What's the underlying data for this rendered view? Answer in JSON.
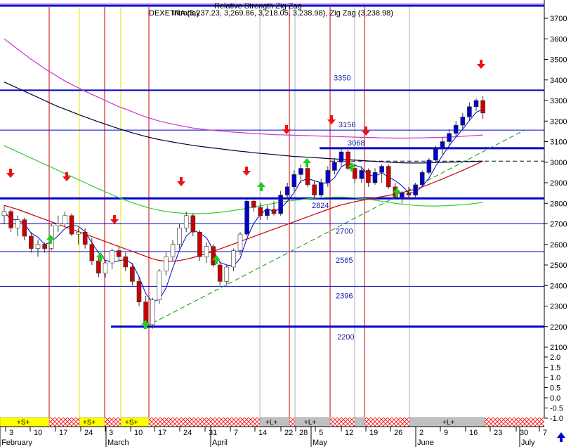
{
  "header": {
    "title_overlay": "Relative Strength Zig Zag",
    "sub_overlay": "Intraday",
    "ohlc_text": "DEXETRA (3,237.23, 3,269.86, 3,218.05, 3,238.98), Zig Zag (3,238.98)"
  },
  "colors": {
    "level_line": "#0000cc",
    "uptrend": "#009900",
    "ma_magenta": "#cc33cc",
    "ma_navy": "#000033",
    "ma_green": "#33cc33",
    "ma_red": "#cc0000",
    "band_s": "#ffff00",
    "band_l": "#c0c0c0",
    "hatch": "#ff0000",
    "cycle_red": "#cc0000",
    "cycle_yellow": "#e8e000",
    "cycle_gray": "#b0b0b0"
  },
  "band_labels": [
    "+S+",
    "+S+",
    "+S+",
    "+L+",
    "+L+",
    "+L+"
  ],
  "scroll_icon": "arrow-up-icon",
  "chart_data": {
    "type": "candlestick",
    "title": "",
    "yticks": [
      3700,
      3600,
      3500,
      3400,
      3300,
      3200,
      3100,
      3000,
      2900,
      2800,
      2700,
      2600,
      2500,
      2400,
      2300,
      2200,
      2100
    ],
    "osc_ticks": [
      "2.0",
      "1.5",
      "1.0",
      "0.5",
      "0.0",
      "-0.5",
      "-1.0"
    ],
    "ylim": [
      2000,
      3750
    ],
    "x_ticks": [
      "3",
      "10",
      "17",
      "24",
      "3",
      "10",
      "17",
      "24",
      "31",
      "7",
      "14",
      "22",
      "28",
      "5",
      "12",
      "19",
      "26",
      "2",
      "9",
      "16",
      "23",
      "30",
      "7"
    ],
    "month_labels": [
      "February",
      "March",
      "April",
      "May",
      "June",
      "July"
    ],
    "levels": [
      {
        "value": 3350,
        "label": "3350"
      },
      {
        "value": 3156,
        "label": "3156"
      },
      {
        "value": 3068,
        "label": "3068"
      },
      {
        "value": 2824,
        "label": "2824"
      },
      {
        "value": 2700,
        "label": "2700"
      },
      {
        "value": 2565,
        "label": "2565"
      },
      {
        "value": 2396,
        "label": "2396"
      },
      {
        "value": 2200,
        "label": "2200"
      }
    ],
    "candles": [
      {
        "o": 2740,
        "h": 2790,
        "l": 2700,
        "c": 2760
      },
      {
        "o": 2760,
        "h": 2770,
        "l": 2660,
        "c": 2680
      },
      {
        "o": 2680,
        "h": 2740,
        "l": 2640,
        "c": 2720
      },
      {
        "o": 2720,
        "h": 2730,
        "l": 2620,
        "c": 2640
      },
      {
        "o": 2640,
        "h": 2660,
        "l": 2560,
        "c": 2580
      },
      {
        "o": 2580,
        "h": 2620,
        "l": 2540,
        "c": 2600
      },
      {
        "o": 2600,
        "h": 2610,
        "l": 2560,
        "c": 2580
      },
      {
        "o": 2580,
        "h": 2700,
        "l": 2570,
        "c": 2690
      },
      {
        "o": 2690,
        "h": 2740,
        "l": 2660,
        "c": 2700
      },
      {
        "o": 2700,
        "h": 2760,
        "l": 2690,
        "c": 2740
      },
      {
        "o": 2740,
        "h": 2750,
        "l": 2640,
        "c": 2650
      },
      {
        "o": 2650,
        "h": 2680,
        "l": 2600,
        "c": 2660
      },
      {
        "o": 2660,
        "h": 2680,
        "l": 2580,
        "c": 2600
      },
      {
        "o": 2600,
        "h": 2630,
        "l": 2500,
        "c": 2520
      },
      {
        "o": 2520,
        "h": 2550,
        "l": 2440,
        "c": 2460
      },
      {
        "o": 2460,
        "h": 2520,
        "l": 2440,
        "c": 2510
      },
      {
        "o": 2510,
        "h": 2580,
        "l": 2480,
        "c": 2570
      },
      {
        "o": 2570,
        "h": 2590,
        "l": 2520,
        "c": 2540
      },
      {
        "o": 2540,
        "h": 2560,
        "l": 2470,
        "c": 2490
      },
      {
        "o": 2490,
        "h": 2510,
        "l": 2400,
        "c": 2420
      },
      {
        "o": 2420,
        "h": 2440,
        "l": 2300,
        "c": 2320
      },
      {
        "o": 2320,
        "h": 2350,
        "l": 2200,
        "c": 2210
      },
      {
        "o": 2210,
        "h": 2340,
        "l": 2190,
        "c": 2330
      },
      {
        "o": 2330,
        "h": 2480,
        "l": 2310,
        "c": 2470
      },
      {
        "o": 2470,
        "h": 2560,
        "l": 2450,
        "c": 2540
      },
      {
        "o": 2540,
        "h": 2620,
        "l": 2520,
        "c": 2600
      },
      {
        "o": 2600,
        "h": 2700,
        "l": 2580,
        "c": 2680
      },
      {
        "o": 2680,
        "h": 2760,
        "l": 2660,
        "c": 2740
      },
      {
        "o": 2740,
        "h": 2750,
        "l": 2640,
        "c": 2660
      },
      {
        "o": 2660,
        "h": 2670,
        "l": 2520,
        "c": 2540
      },
      {
        "o": 2540,
        "h": 2610,
        "l": 2510,
        "c": 2590
      },
      {
        "o": 2590,
        "h": 2600,
        "l": 2490,
        "c": 2500
      },
      {
        "o": 2500,
        "h": 2520,
        "l": 2400,
        "c": 2420
      },
      {
        "o": 2420,
        "h": 2500,
        "l": 2400,
        "c": 2490
      },
      {
        "o": 2490,
        "h": 2580,
        "l": 2470,
        "c": 2570
      },
      {
        "o": 2570,
        "h": 2660,
        "l": 2550,
        "c": 2650
      },
      {
        "o": 2650,
        "h": 2820,
        "l": 2640,
        "c": 2810
      },
      {
        "o": 2810,
        "h": 2830,
        "l": 2760,
        "c": 2780
      },
      {
        "o": 2780,
        "h": 2800,
        "l": 2720,
        "c": 2740
      },
      {
        "o": 2740,
        "h": 2790,
        "l": 2720,
        "c": 2770
      },
      {
        "o": 2770,
        "h": 2810,
        "l": 2740,
        "c": 2750
      },
      {
        "o": 2750,
        "h": 2860,
        "l": 2740,
        "c": 2840
      },
      {
        "o": 2840,
        "h": 2900,
        "l": 2820,
        "c": 2880
      },
      {
        "o": 2880,
        "h": 2960,
        "l": 2860,
        "c": 2940
      },
      {
        "o": 2940,
        "h": 2990,
        "l": 2900,
        "c": 2970
      },
      {
        "o": 2970,
        "h": 3000,
        "l": 2880,
        "c": 2890
      },
      {
        "o": 2890,
        "h": 2910,
        "l": 2820,
        "c": 2840
      },
      {
        "o": 2840,
        "h": 2920,
        "l": 2830,
        "c": 2900
      },
      {
        "o": 2900,
        "h": 2980,
        "l": 2880,
        "c": 2960
      },
      {
        "o": 2960,
        "h": 3020,
        "l": 2940,
        "c": 3000
      },
      {
        "o": 3000,
        "h": 3070,
        "l": 2980,
        "c": 3050
      },
      {
        "o": 3050,
        "h": 3060,
        "l": 2960,
        "c": 2970
      },
      {
        "o": 2970,
        "h": 2990,
        "l": 2900,
        "c": 2920
      },
      {
        "o": 2920,
        "h": 2980,
        "l": 2900,
        "c": 2960
      },
      {
        "o": 2960,
        "h": 2970,
        "l": 2880,
        "c": 2900
      },
      {
        "o": 2900,
        "h": 2970,
        "l": 2890,
        "c": 2950
      },
      {
        "o": 2950,
        "h": 2990,
        "l": 2900,
        "c": 2980
      },
      {
        "o": 2980,
        "h": 2990,
        "l": 2870,
        "c": 2880
      },
      {
        "o": 2880,
        "h": 2900,
        "l": 2820,
        "c": 2830
      },
      {
        "o": 2830,
        "h": 2860,
        "l": 2800,
        "c": 2850
      },
      {
        "o": 2850,
        "h": 2880,
        "l": 2820,
        "c": 2840
      },
      {
        "o": 2840,
        "h": 2900,
        "l": 2830,
        "c": 2890
      },
      {
        "o": 2890,
        "h": 2960,
        "l": 2880,
        "c": 2950
      },
      {
        "o": 2950,
        "h": 3020,
        "l": 2940,
        "c": 3010
      },
      {
        "o": 3010,
        "h": 3080,
        "l": 3000,
        "c": 3070
      },
      {
        "o": 3070,
        "h": 3120,
        "l": 3040,
        "c": 3100
      },
      {
        "o": 3100,
        "h": 3160,
        "l": 3080,
        "c": 3140
      },
      {
        "o": 3140,
        "h": 3200,
        "l": 3120,
        "c": 3180
      },
      {
        "o": 3180,
        "h": 3240,
        "l": 3160,
        "c": 3220
      },
      {
        "o": 3220,
        "h": 3290,
        "l": 3200,
        "c": 3270
      },
      {
        "o": 3270,
        "h": 3310,
        "l": 3250,
        "c": 3300
      },
      {
        "o": 3300,
        "h": 3320,
        "l": 3210,
        "c": 3238.98
      }
    ],
    "ma_magenta": [
      3600,
      3575,
      3550,
      3525,
      3500,
      3478,
      3455,
      3435,
      3415,
      3395,
      3378,
      3362,
      3345,
      3330,
      3315,
      3300,
      3285,
      3270,
      3258,
      3245,
      3232,
      3220,
      3210,
      3200,
      3192,
      3185,
      3178,
      3172,
      3166,
      3162,
      3158,
      3155,
      3152,
      3149,
      3146,
      3144,
      3142,
      3140,
      3138,
      3136,
      3134,
      3133,
      3132,
      3131,
      3130,
      3129,
      3128,
      3127,
      3126,
      3125,
      3124,
      3123,
      3122,
      3121,
      3120,
      3119,
      3118,
      3118,
      3117,
      3117,
      3117,
      3118,
      3118,
      3119,
      3120,
      3121,
      3122,
      3124,
      3126,
      3128,
      3130,
      3132
    ],
    "ma_navy": [
      3390,
      3375,
      3360,
      3345,
      3330,
      3315,
      3300,
      3285,
      3270,
      3258,
      3245,
      3232,
      3220,
      3208,
      3196,
      3185,
      3174,
      3163,
      3153,
      3143,
      3134,
      3125,
      3117,
      3110,
      3104,
      3098,
      3092,
      3087,
      3082,
      3077,
      3073,
      3069,
      3065,
      3061,
      3057,
      3053,
      3050,
      3046,
      3043,
      3040,
      3037,
      3034,
      3031,
      3028,
      3026,
      3024,
      3022,
      3020,
      3018,
      3016,
      3014,
      3012,
      3010,
      3008,
      3006,
      3004,
      3002,
      3000,
      2998,
      2997,
      2996,
      2996,
      2996,
      2997,
      2998,
      2999,
      3000,
      3001,
      3002,
      3003,
      3004,
      3005
    ],
    "ma_green": [
      3080,
      3065,
      3050,
      3035,
      3020,
      3005,
      2990,
      2975,
      2960,
      2945,
      2930,
      2915,
      2900,
      2885,
      2870,
      2856,
      2842,
      2828,
      2815,
      2803,
      2792,
      2782,
      2773,
      2766,
      2760,
      2756,
      2753,
      2751,
      2750,
      2750,
      2751,
      2753,
      2756,
      2760,
      2765,
      2770,
      2776,
      2782,
      2788,
      2794,
      2800,
      2805,
      2810,
      2814,
      2818,
      2822,
      2825,
      2827,
      2829,
      2830,
      2830,
      2829,
      2827,
      2824,
      2820,
      2815,
      2810,
      2805,
      2800,
      2796,
      2793,
      2790,
      2788,
      2787,
      2787,
      2788,
      2789,
      2791,
      2793,
      2796,
      2800,
      2805
    ],
    "ma_red": [
      2790,
      2780,
      2770,
      2758,
      2746,
      2734,
      2722,
      2710,
      2698,
      2686,
      2674,
      2662,
      2650,
      2638,
      2626,
      2614,
      2602,
      2590,
      2578,
      2566,
      2554,
      2542,
      2530,
      2522,
      2518,
      2518,
      2522,
      2528,
      2536,
      2546,
      2556,
      2566,
      2578,
      2590,
      2602,
      2614,
      2626,
      2638,
      2650,
      2662,
      2674,
      2686,
      2698,
      2710,
      2722,
      2734,
      2746,
      2758,
      2770,
      2782,
      2792,
      2800,
      2808,
      2814,
      2820,
      2826,
      2832,
      2838,
      2845,
      2852,
      2860,
      2870,
      2880,
      2892,
      2905,
      2918,
      2932,
      2946,
      2960,
      2975,
      2990,
      3005
    ],
    "zigzag_up": [
      {
        "i": 21,
        "v": 2200
      },
      {
        "i": 70,
        "v": 3175
      }
    ]
  }
}
